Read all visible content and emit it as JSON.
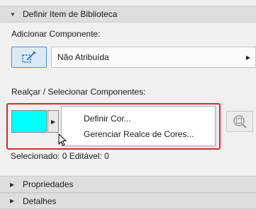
{
  "panel": {
    "header_title": "Definir Item de Biblioteca",
    "add_component_label": "Adicionar Componente:",
    "component_value": "Não Atribuída",
    "highlight_label": "Realçar / Selecionar Componentes:",
    "status_text": "Selecionado: 0 Editável: 0"
  },
  "highlight": {
    "color": "#00FFFF"
  },
  "menu": {
    "items": [
      {
        "label": "Definir Cor..."
      },
      {
        "label": "Gerenciar Realce de Cores..."
      }
    ]
  },
  "sections": [
    {
      "label": "Propriedades"
    },
    {
      "label": "Detalhes"
    }
  ],
  "icons": {
    "expand": "triangle-down-icon",
    "collapsed": "triangle-right-icon",
    "component": "draw-component-icon",
    "zoom": "zoom-icon"
  }
}
